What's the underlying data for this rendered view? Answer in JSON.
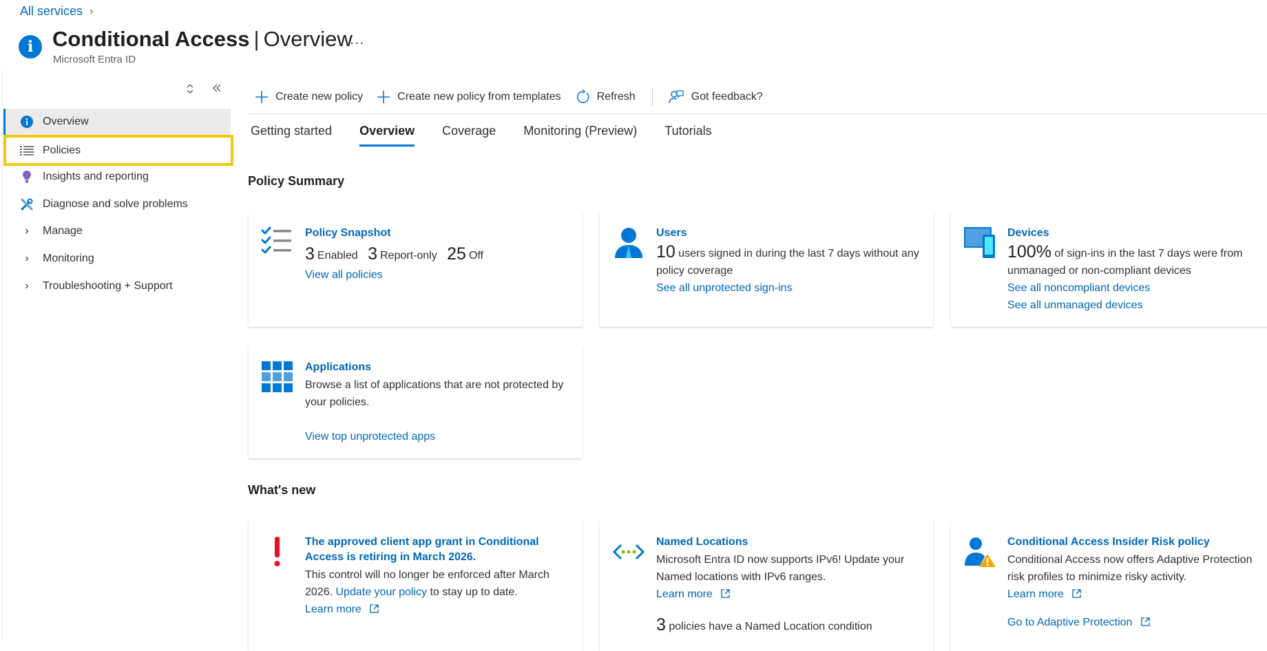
{
  "breadcrumb": {
    "label": "All services"
  },
  "header": {
    "title": "Conditional Access",
    "separator": "|",
    "subtitle_page": "Overview",
    "more": "...",
    "service": "Microsoft Entra ID"
  },
  "sidebar": {
    "items": [
      {
        "label": "Overview",
        "icon": "info-icon"
      },
      {
        "label": "Policies",
        "icon": "list-icon"
      },
      {
        "label": "Insights and reporting",
        "icon": "lightbulb-icon"
      },
      {
        "label": "Diagnose and solve problems",
        "icon": "wrench-icon"
      },
      {
        "label": "Manage",
        "icon": "chevron-right-icon"
      },
      {
        "label": "Monitoring",
        "icon": "chevron-right-icon"
      },
      {
        "label": "Troubleshooting + Support",
        "icon": "chevron-right-icon"
      }
    ]
  },
  "toolbar": {
    "create_policy": "Create new policy",
    "create_from_templates": "Create new policy from templates",
    "refresh": "Refresh",
    "feedback": "Got feedback?"
  },
  "tabs": [
    "Getting started",
    "Overview",
    "Coverage",
    "Monitoring (Preview)",
    "Tutorials"
  ],
  "policy_summary": {
    "heading": "Policy Summary",
    "snapshot": {
      "title": "Policy Snapshot",
      "enabled_count": "3",
      "enabled_label": "Enabled",
      "report_count": "3",
      "report_label": "Report-only",
      "off_count": "25",
      "off_label": "Off",
      "link": "View all policies"
    },
    "users": {
      "title": "Users",
      "count": "10",
      "text": "users signed in during the last 7 days without any policy coverage",
      "link": "See all unprotected sign-ins"
    },
    "devices": {
      "title": "Devices",
      "percent": "100%",
      "text": "of sign-ins in the last 7 days were from unmanaged or non-compliant devices",
      "link1": "See all noncompliant devices",
      "link2": "See all unmanaged devices"
    },
    "applications": {
      "title": "Applications",
      "text": "Browse a list of applications that are not protected by your policies.",
      "link": "View top unprotected apps"
    }
  },
  "whats_new": {
    "heading": "What's new",
    "grant": {
      "title": "The approved client app grant in Conditional Access is retiring in March 2026.",
      "text_before": "This control will no longer be enforced after March 2026.",
      "inline_link": "Update your policy",
      "text_after": "to stay up to date.",
      "link": "Learn more"
    },
    "named": {
      "title": "Named Locations",
      "text": "Microsoft Entra ID now supports IPv6! Update your Named locations with IPv6 ranges.",
      "link": "Learn more",
      "count": "3",
      "count_text": "policies have a Named Location condition"
    },
    "insider": {
      "title": "Conditional Access Insider Risk policy",
      "text": "Conditional Access now offers Adaptive Protection risk profiles to minimize risky activity.",
      "link": "Learn more",
      "link2": "Go to Adaptive Protection"
    }
  },
  "colors": {
    "accent": "#0078d4",
    "link": "#0067b8",
    "highlight": "#f2c811",
    "alert": "#e81123"
  }
}
